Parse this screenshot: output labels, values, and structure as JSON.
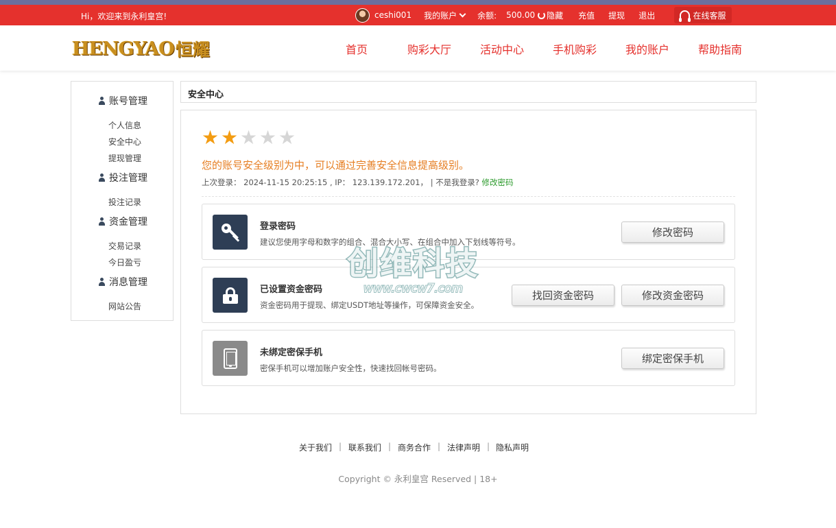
{
  "topbar": {
    "welcome": "Hi，欢迎来到永利皇宫!",
    "username": "ceshi001",
    "my_account": "我的账户",
    "balance_label": "余额:",
    "balance_value": "500.00",
    "hide": "隐藏",
    "recharge": "充值",
    "withdraw": "提现",
    "logout": "退出",
    "customer_service": "在线客服"
  },
  "header": {
    "logo_text": "HENGYAO",
    "logo_cn": "恒耀",
    "nav": [
      "首页",
      "购彩大厅",
      "活动中心",
      "手机购彩",
      "我的账户",
      "帮助指南"
    ]
  },
  "sidebar": {
    "groups": [
      {
        "title": "账号管理",
        "items": [
          "个人信息",
          "安全中心",
          "提现管理"
        ]
      },
      {
        "title": "投注管理",
        "items": [
          "投注记录"
        ]
      },
      {
        "title": "资金管理",
        "items": [
          "交易记录",
          "今日盈亏"
        ]
      },
      {
        "title": "消息管理",
        "items": [
          "网站公告"
        ]
      }
    ]
  },
  "breadcrumb": "安全中心",
  "security": {
    "stars_filled": 2,
    "stars_total": 5,
    "level_text": "您的账号安全级别为中，可以通过完善安全信息提高级别。",
    "last_login_label": "上次登录：",
    "last_login_time": "2024-11-15 20:25:15",
    "ip_label": "IP：",
    "ip": "123.139.172.201，",
    "not_me": "| 不是我登录?",
    "change_pwd_link": "修改密码"
  },
  "cards": [
    {
      "title": "登录密码",
      "desc": "建议您使用字母和数字的组合、混合大小写、在组合中加入下划线等符号。",
      "buttons": [
        "修改密码"
      ]
    },
    {
      "title": "已设置资金密码",
      "desc": "资金密码用于提现、绑定USDT地址等操作，可保障资金安全。",
      "buttons": [
        "找回资金密码",
        "修改资金密码"
      ]
    },
    {
      "title": "未绑定密保手机",
      "desc": "密保手机可以增加账户安全性，快速找回帐号密码。",
      "buttons": [
        "绑定密保手机"
      ]
    }
  ],
  "watermark": {
    "cn": "创维科技",
    "url": "www.cwcw7.com"
  },
  "footer": {
    "links": [
      "关于我们",
      "联系我们",
      "商务合作",
      "法律声明",
      "隐私声明"
    ],
    "copyright": "Copyright © 永利皇宫 Reserved | 18+"
  }
}
